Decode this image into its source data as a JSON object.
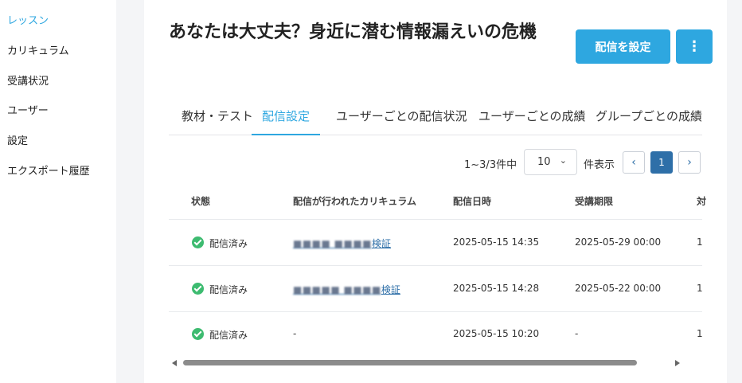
{
  "sidebar": {
    "items": [
      {
        "label": "レッスン",
        "active": true
      },
      {
        "label": "カリキュラム"
      },
      {
        "label": "受講状況"
      },
      {
        "label": "ユーザー"
      },
      {
        "label": "設定"
      },
      {
        "label": "エクスポート履歴"
      }
    ]
  },
  "page": {
    "title": "あなたは大丈夫？身近に潜む情報漏えいの危機",
    "primary_button": "配信を設定",
    "more_button": "⋮"
  },
  "tabs": [
    {
      "label": "教材・テスト"
    },
    {
      "label": "配信設定",
      "active": true
    },
    {
      "label": "ユーザーごとの配信状況"
    },
    {
      "label": "ユーザーごとの成績"
    },
    {
      "label": "グループごとの成績"
    }
  ],
  "pagination": {
    "count_text": "1~3/3件中",
    "per_page": "10",
    "per_page_label": "件表示",
    "prev": "‹",
    "current": "1",
    "next": "›"
  },
  "table": {
    "columns": [
      "状態",
      "配信が行われたカリキュラム",
      "配信日時",
      "受講期限",
      "対"
    ],
    "rows": [
      {
        "status": "配信済み",
        "curriculum_blur": "■■■■ ■■■■",
        "curriculum_text": "検証",
        "datetime": "2025-05-15 14:35",
        "deadline": "2025-05-29 00:00",
        "extra": "1"
      },
      {
        "status": "配信済み",
        "curriculum_blur": "■■■■■ ■■■■",
        "curriculum_text": "検証",
        "datetime": "2025-05-15 14:28",
        "deadline": "2025-05-22 00:00",
        "extra": "1"
      },
      {
        "status": "配信済み",
        "curriculum_blur": "",
        "curriculum_text": "-",
        "datetime": "2025-05-15 10:20",
        "deadline": "-",
        "extra": "1"
      }
    ]
  },
  "colors": {
    "accent": "#2ea7e0",
    "link": "#2e6fa8",
    "success": "#3dbb70"
  }
}
